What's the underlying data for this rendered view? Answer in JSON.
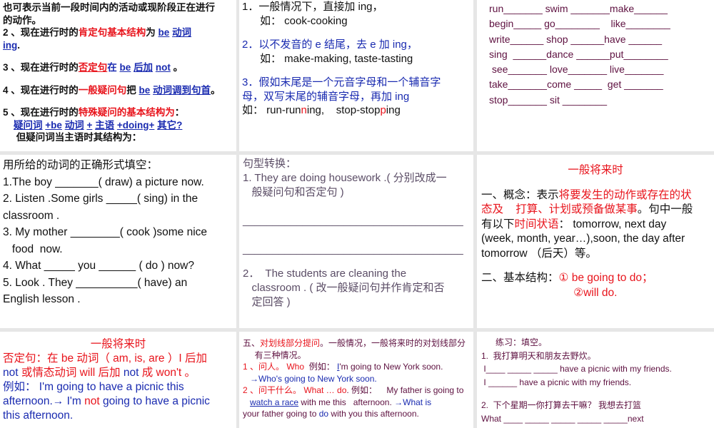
{
  "panels": [
    {
      "lines": [
        [
          [
            "也可表示当前一段时间内的活动或现阶段正在进行",
            ""
          ]
        ],
        [
          [
            "的动作。",
            ""
          ]
        ],
        [
          [
            "2 、现在进行时的",
            ""
          ],
          [
            "肯定句基本结构",
            ""
          ],
          [
            "为 ",
            ""
          ],
          [
            "be",
            ""
          ],
          [
            " ",
            ""
          ],
          [
            "动词",
            ""
          ]
        ],
        [
          [
            "ing",
            ""
          ],
          [
            ".",
            ""
          ]
        ],
        [],
        [
          [
            "3 、现在进行时的",
            ""
          ],
          [
            "否定句",
            ""
          ],
          [
            "在 ",
            ""
          ],
          [
            "be",
            ""
          ],
          [
            " ",
            ""
          ],
          [
            "后加",
            ""
          ],
          [
            " ",
            ""
          ],
          [
            "not",
            ""
          ],
          [
            " 。",
            ""
          ]
        ],
        [],
        [
          [
            "4 、现在进行时的",
            ""
          ],
          [
            "一般疑问句",
            ""
          ],
          [
            "把 ",
            ""
          ],
          [
            "be",
            ""
          ],
          [
            " ",
            ""
          ],
          [
            "动词调到句首",
            ""
          ],
          [
            "。",
            ""
          ]
        ],
        [],
        [
          [
            "5 、现在进行时的",
            ""
          ],
          [
            "特殊疑问的基本结构为",
            ""
          ],
          [
            "：",
            ""
          ]
        ],
        [
          [
            "    ",
            ""
          ],
          [
            "疑问词",
            ""
          ],
          [
            " ",
            ""
          ],
          [
            "+be",
            ""
          ],
          [
            " ",
            ""
          ],
          [
            "动词",
            ""
          ],
          [
            " ",
            ""
          ],
          [
            "+",
            ""
          ],
          [
            " ",
            ""
          ],
          [
            "主语",
            ""
          ],
          [
            " ",
            ""
          ],
          [
            "+doing+",
            ""
          ],
          [
            " ",
            ""
          ],
          [
            "其它?",
            ""
          ]
        ],
        [
          [
            "     但疑问词当主语时其结构为：",
            ""
          ]
        ]
      ],
      "styles": [
        [
          ""
        ],
        [
          ""
        ],
        [
          "",
          "r",
          "",
          "u",
          "",
          "u"
        ],
        [
          "u",
          ""
        ],
        [],
        [
          "",
          "ru",
          "b",
          "u",
          "",
          "u",
          "",
          "u",
          ""
        ],
        [],
        [
          "",
          "r",
          "",
          "u",
          "",
          "u",
          ""
        ],
        [],
        [
          "",
          "r",
          ""
        ],
        [
          "",
          "u",
          "",
          "u",
          "",
          "u",
          "",
          "u",
          "",
          "u",
          "",
          "u",
          "",
          "u"
        ],
        [
          ""
        ]
      ]
    },
    {
      "lines": [
        [
          [
            "1．一般情况下，直接加 ing，",
            ""
          ]
        ],
        [
          [
            "      如： cook-cooking",
            ""
          ]
        ],
        [],
        [
          [
            "2．以不发音的 e 结尾，去 e 加 ing，",
            ""
          ]
        ],
        [
          [
            "      如： make-making, taste-tasting",
            ""
          ]
        ],
        [],
        [
          [
            "3．假如末尾是一个元音字母和一个辅音字",
            ""
          ]
        ],
        [
          [
            "母，双写末尾的辅音字母，再加 ing",
            ""
          ]
        ],
        [
          [
            "如： run-run",
            ""
          ],
          [
            "n",
            ""
          ],
          [
            "ing,    stop-stop",
            ""
          ],
          [
            "p",
            ""
          ],
          [
            "ing",
            ""
          ]
        ]
      ],
      "styles": [
        [
          ""
        ],
        [
          ""
        ],
        [],
        [
          "b"
        ],
        [
          ""
        ],
        [],
        [
          "b"
        ],
        [
          "b"
        ],
        [
          "",
          "r",
          "",
          "r",
          ""
        ]
      ]
    },
    {
      "lines": [
        [
          [
            "run_______ swim _______make______",
            ""
          ]
        ],
        [
          [
            "begin_____ go________    like________",
            ""
          ]
        ],
        [
          [
            "write______ shop ______have ______",
            ""
          ]
        ],
        [
          [
            "sing  ______dance ______put________",
            ""
          ]
        ],
        [
          [
            " see_______ love_______ live_______",
            ""
          ]
        ],
        [
          [
            "take_______come _____  get _______",
            ""
          ]
        ],
        [
          [
            "stop_______ sit ________",
            ""
          ]
        ]
      ],
      "styles": [
        [
          ""
        ],
        [
          ""
        ],
        [
          ""
        ],
        [
          ""
        ],
        [
          ""
        ],
        [
          ""
        ],
        [
          ""
        ]
      ]
    },
    {
      "lines": [
        [
          [
            "用所给的动词的正确形式填空：",
            ""
          ]
        ],
        [
          [
            "1.The boy _______( draw) a picture now.",
            ""
          ]
        ],
        [
          [
            "2. Listen .Some girls _____( sing) in the",
            ""
          ]
        ],
        [
          [
            "classroom .",
            ""
          ]
        ],
        [
          [
            "3. My mother ________( cook )some nice",
            ""
          ]
        ],
        [
          [
            "   food  now.",
            ""
          ]
        ],
        [
          [
            "4. What _____ you ______ ( do ) now?",
            ""
          ]
        ],
        [
          [
            "5. Look . They __________( have) an",
            ""
          ]
        ],
        [
          [
            "English lesson .",
            ""
          ]
        ]
      ],
      "styles": [
        [
          ""
        ],
        [
          ""
        ],
        [
          ""
        ],
        [
          ""
        ],
        [
          ""
        ],
        [
          ""
        ],
        [
          ""
        ],
        [
          ""
        ],
        [
          ""
        ]
      ]
    },
    {
      "lines": [
        [
          [
            "句型转换：",
            ""
          ]
        ],
        [
          [
            "1. They are doing housework .( 分别改成一",
            ""
          ]
        ],
        [
          [
            "   般疑问句和否定句 )",
            ""
          ]
        ],
        [
          [
            "   _____________________________________",
            ""
          ]
        ],
        [
          [
            "   _____________________________________",
            ""
          ]
        ],
        [],
        [
          [
            "2．  The students are cleaning the",
            ""
          ]
        ],
        [
          [
            "   classroom . ( 改一般疑问句并作肯定和否",
            ""
          ]
        ],
        [
          [
            "   定回答 )",
            ""
          ]
        ],
        [
          [
            "   _____________________________________",
            ""
          ]
        ],
        [
          [
            "   _____________________________________",
            ""
          ]
        ]
      ],
      "styles": [
        [
          ""
        ],
        [
          ""
        ],
        [
          ""
        ],
        [
          ""
        ],
        [
          ""
        ],
        [],
        [
          ""
        ],
        [
          ""
        ],
        [
          ""
        ],
        [
          ""
        ],
        [
          ""
        ]
      ]
    },
    {
      "lines": [
        [
          [
            "一般将来时",
            ""
          ]
        ],
        [],
        [
          [
            "一、概念：表示",
            ""
          ],
          [
            "将要发生的动作或存在的状",
            ""
          ]
        ],
        [
          [
            "态及",
            ""
          ],
          [
            "    打算、计划或预备做某事",
            ""
          ],
          [
            "。句中一般",
            ""
          ]
        ],
        [
          [
            "有以下",
            ""
          ],
          [
            "时间状语",
            ""
          ],
          [
            "： tomorrow, next day",
            ""
          ]
        ],
        [
          [
            "(week, month, year…),soon, the day after",
            ""
          ]
        ],
        [
          [
            "tomorrow （后天）等。",
            ""
          ]
        ],
        [],
        [
          [
            "二、基本结构：",
            ""
          ],
          [
            "① be going to do；",
            ""
          ]
        ],
        [
          [
            "                              ",
            ""
          ],
          [
            "②will do.",
            ""
          ]
        ]
      ],
      "styles": [
        [
          "r"
        ],
        [],
        [
          "",
          "r"
        ],
        [
          "r",
          "r",
          ""
        ],
        [
          "",
          "r",
          ""
        ],
        [
          ""
        ],
        [
          ""
        ],
        [],
        [
          "",
          "r"
        ],
        [
          "",
          "r"
        ]
      ]
    },
    {
      "lines": [
        [
          [
            "一般将来时",
            ""
          ]
        ],
        [
          [
            "否定句",
            ""
          ],
          [
            "：在 be 动词（ am, is, are ）I 后加",
            ""
          ]
        ],
        [
          [
            "not",
            ""
          ],
          [
            " 或情态动词 will 后加 ",
            ""
          ],
          [
            "not",
            ""
          ],
          [
            " 成 won't 。",
            ""
          ]
        ],
        [
          [
            "例如： I'm going to have a picnic this",
            ""
          ]
        ],
        [
          [
            "afternoon.→ I'm ",
            ""
          ],
          [
            "not",
            ""
          ],
          [
            " going to have a picnic",
            ""
          ]
        ],
        [
          [
            "this afternoon.",
            ""
          ]
        ]
      ],
      "styles": [
        [
          "r"
        ],
        [
          "r",
          "r"
        ],
        [
          "b",
          "r",
          "b",
          "r"
        ],
        [
          "b"
        ],
        [
          "b",
          "r",
          "b"
        ],
        [
          "b"
        ]
      ]
    },
    {
      "lines": [
        [
          [
            "五、",
            ""
          ],
          [
            "对划线部分提问",
            ""
          ],
          [
            "。一般情况，一般将来时的对划线部分",
            ""
          ]
        ],
        [
          [
            "     有三种情况。",
            ""
          ]
        ],
        [
          [
            "1 、问人。 Who",
            ""
          ],
          [
            "  例如： ",
            ""
          ],
          [
            "I",
            ""
          ],
          [
            "'m going to New York soon.",
            ""
          ]
        ],
        [
          [
            "   →Who's going to New York soon.",
            ""
          ]
        ],
        [
          [
            "2 、问干什么。 What … do",
            ""
          ],
          [
            ". 例如：    My father is going to",
            ""
          ]
        ],
        [
          [
            "   ",
            ""
          ],
          [
            "watch a race",
            ""
          ],
          [
            " with me this   afternoon. ",
            ""
          ],
          [
            "→What is",
            ""
          ]
        ],
        [
          [
            "your father going to ",
            ""
          ],
          [
            "do",
            ""
          ],
          [
            " with you this afternoon.",
            ""
          ]
        ]
      ],
      "styles": [
        [
          "",
          "r",
          ""
        ],
        [
          ""
        ],
        [
          "r",
          "",
          "u",
          ""
        ],
        [
          "b"
        ],
        [
          "r",
          ""
        ],
        [
          "",
          "u",
          "",
          "b"
        ],
        [
          "",
          "b",
          ""
        ]
      ]
    },
    {
      "lines": [
        [
          [
            "      练习：填空。",
            ""
          ]
        ],
        [
          [
            "1.  我打算明天和朋友去野炊。",
            ""
          ]
        ],
        [
          [
            " I____ _____ _____ have a picnic with my friends.",
            ""
          ]
        ],
        [
          [
            " I ______ have a picnic with my friends.",
            ""
          ]
        ],
        [],
        [
          [
            "2.  下个星期一你打算去干嘛？ 我想去打篮",
            ""
          ]
        ],
        [
          [
            "What ____ _____ _____ _____ _____next",
            ""
          ]
        ]
      ],
      "styles": [
        [
          ""
        ],
        [
          ""
        ],
        [
          ""
        ],
        [
          ""
        ],
        [],
        [
          ""
        ],
        [
          ""
        ]
      ]
    }
  ]
}
